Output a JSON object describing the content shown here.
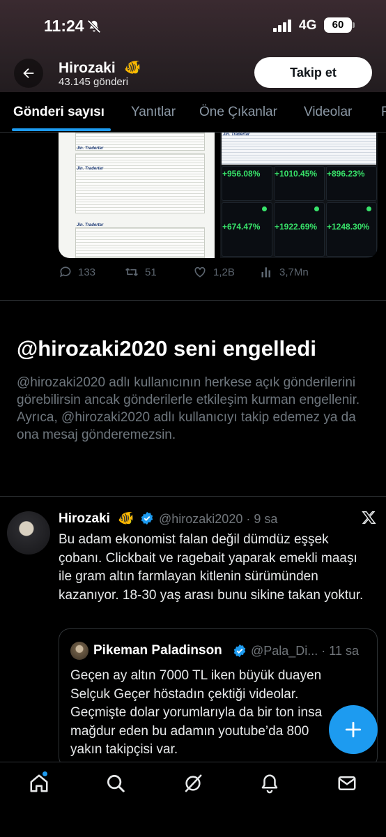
{
  "status_bar": {
    "time": "11:24",
    "network": "4G",
    "battery": "60",
    "icons": [
      "bell-off-icon",
      "signal-icon",
      "battery-icon"
    ]
  },
  "header": {
    "back_icon": "arrow-left-icon",
    "name": "Hirozaki",
    "name_emoji": "🐠",
    "post_count": "43.145 gönderi",
    "follow_label": "Takip et"
  },
  "tabs": [
    {
      "label": "Gönderi sayısı",
      "active": true
    },
    {
      "label": "Yanıtlar",
      "active": false
    },
    {
      "label": "Öne Çıkanlar",
      "active": false
    },
    {
      "label": "Videolar",
      "active": false
    },
    {
      "label": "F",
      "active": false
    }
  ],
  "prev_post": {
    "media_left": {
      "sheet_titles": [
        "Jin. Tradertar",
        "Jin. Tradertar",
        "Jin. Tradertar"
      ]
    },
    "media_right": {
      "sheet_title": "Jin. Tradertar",
      "percents": [
        "+956.08%",
        "+1010.45%",
        "+896.23%",
        "+674.47%",
        "+1922.69%",
        "+1248.30%"
      ]
    },
    "actions": {
      "replies": "133",
      "reposts": "51",
      "likes": "1,2B",
      "views": "3,7Mn"
    }
  },
  "blocked": {
    "title": "@hirozaki2020 seni engelledi",
    "body": "@hirozaki2020 adlı kullanıcının herkese açık gönderilerini görebilirsin ancak gönderilerle etkileşim kurman engellenir. Ayrıca, @hirozaki2020 adlı kullanıcıyı takip edemez ya da ona mesaj gönderemezsin."
  },
  "tweet": {
    "name": "Hirozaki",
    "name_emoji": "🐠",
    "handle_time": "@hirozaki2020 · 9 sa",
    "text": "Bu adam ekonomist falan değil dümdüz eşşek çobanı. Clickbait ve ragebait yaparak emekli maaşı ile gram altın farmlayan kitlenin sürümünden kazanıyor. 18-30 yaş arası bunu sikine takan yoktur.",
    "quote": {
      "name": "Pikeman Paladinson",
      "handle_time": "@Pala_Di... · 11 sa",
      "lines": [
        "Geçen ay altın 7000 TL iken büyük duayen",
        "Selçuk Geçer höstadın çektiği videolar.",
        "Geçmişte dolar yorumlarıyla da bir ton insa",
        "mağdur eden bu adamın youtube’da 800",
        "yakın takipçisi var."
      ]
    }
  },
  "fab_icon": "plus-icon",
  "bottom_nav": [
    "home-icon",
    "search-icon",
    "grok-icon",
    "notifications-icon",
    "messages-icon"
  ],
  "colors": {
    "accent": "#1d9bf0",
    "background": "#000000",
    "muted_text": "#71767b",
    "gain_green": "#38e36a"
  }
}
